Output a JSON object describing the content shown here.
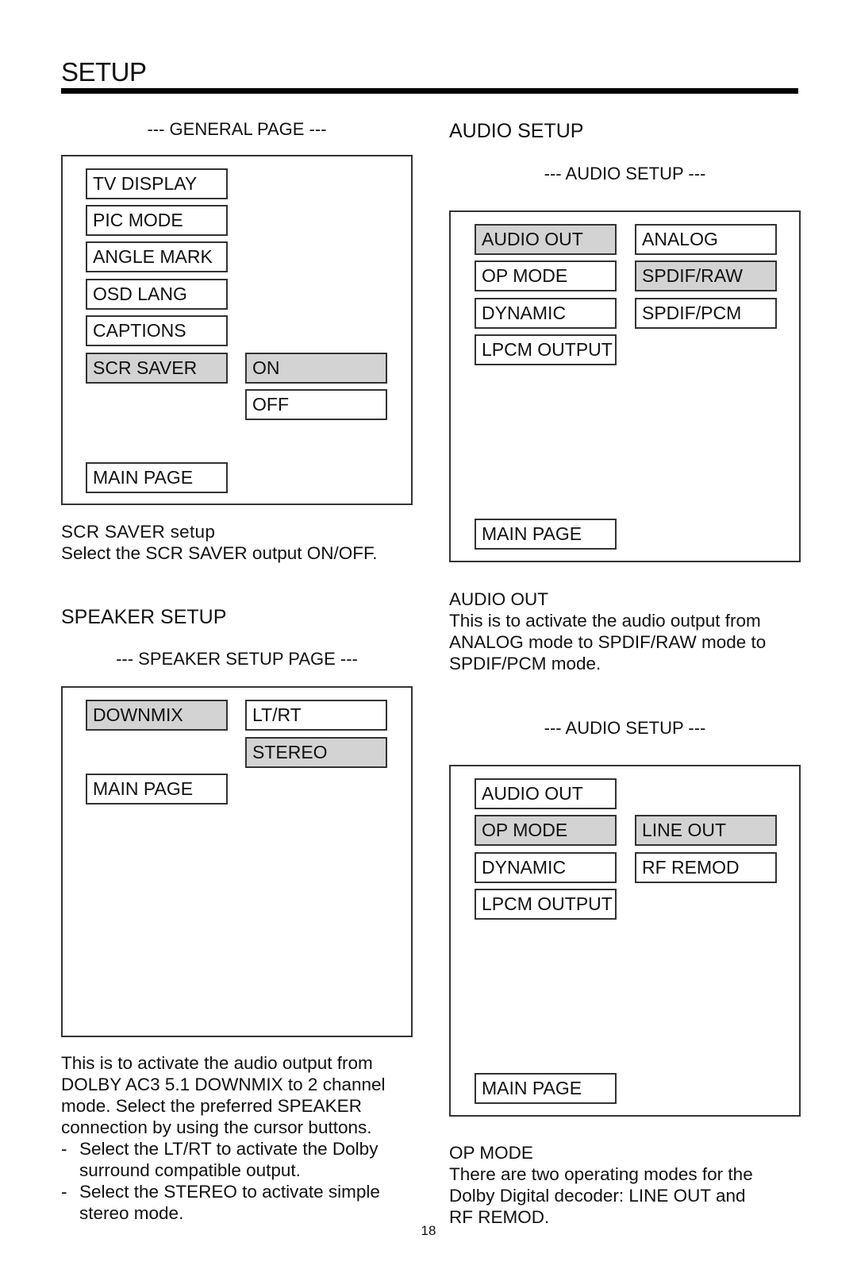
{
  "page": {
    "title": "SETUP",
    "page_number": "18"
  },
  "general": {
    "caption": "--- GENERAL PAGE ---",
    "menu": [
      "TV DISPLAY",
      "PIC MODE",
      "ANGLE MARK",
      "OSD LANG",
      "CAPTIONS",
      "SCR SAVER"
    ],
    "selected_menu": "SCR SAVER",
    "options": [
      "ON",
      "OFF"
    ],
    "selected_option": "ON",
    "main_page": "MAIN PAGE",
    "desc_title": "SCR SAVER setup",
    "desc_text": "Select the SCR SAVER output ON/OFF."
  },
  "speaker": {
    "heading": "SPEAKER SETUP",
    "caption": "--- SPEAKER SETUP PAGE ---",
    "menu": [
      "DOWNMIX"
    ],
    "selected_menu": "DOWNMIX",
    "options": [
      "LT/RT",
      "STEREO"
    ],
    "selected_option": "STEREO",
    "main_page": "MAIN PAGE",
    "desc_lines": [
      "This is to activate the audio output from",
      "DOLBY AC3 5.1 DOWNMIX to 2 channel",
      "mode.  Select the preferred SPEAKER",
      "connection by using the cursor buttons."
    ],
    "bullets": [
      "Select the LT/RT to activate the Dolby surround compatible output.",
      "Select the STEREO to activate simple stereo mode."
    ]
  },
  "audio": {
    "heading": "AUDIO SETUP",
    "panel1": {
      "caption": "--- AUDIO SETUP ---",
      "menu": [
        "AUDIO OUT",
        "OP MODE",
        "DYNAMIC",
        "LPCM OUTPUT"
      ],
      "selected_menu": "AUDIO OUT",
      "options": [
        "ANALOG",
        "SPDIF/RAW",
        "SPDIF/PCM"
      ],
      "selected_option": "SPDIF/RAW",
      "main_page": "MAIN PAGE",
      "desc_title": "AUDIO OUT",
      "desc_lines": [
        "This is to activate the audio output from",
        "ANALOG mode to SPDIF/RAW mode to",
        "SPDIF/PCM mode."
      ]
    },
    "panel2": {
      "caption": "--- AUDIO SETUP ---",
      "menu": [
        "AUDIO OUT",
        "OP MODE",
        "DYNAMIC",
        "LPCM OUTPUT"
      ],
      "selected_menu": "OP MODE",
      "options": [
        "LINE OUT",
        "RF REMOD"
      ],
      "selected_option": "LINE OUT",
      "main_page": "MAIN PAGE",
      "desc_title": "OP MODE",
      "desc_lines": [
        "There are two operating modes for the",
        "Dolby Digital decoder:  LINE OUT and",
        "RF REMOD."
      ]
    }
  }
}
